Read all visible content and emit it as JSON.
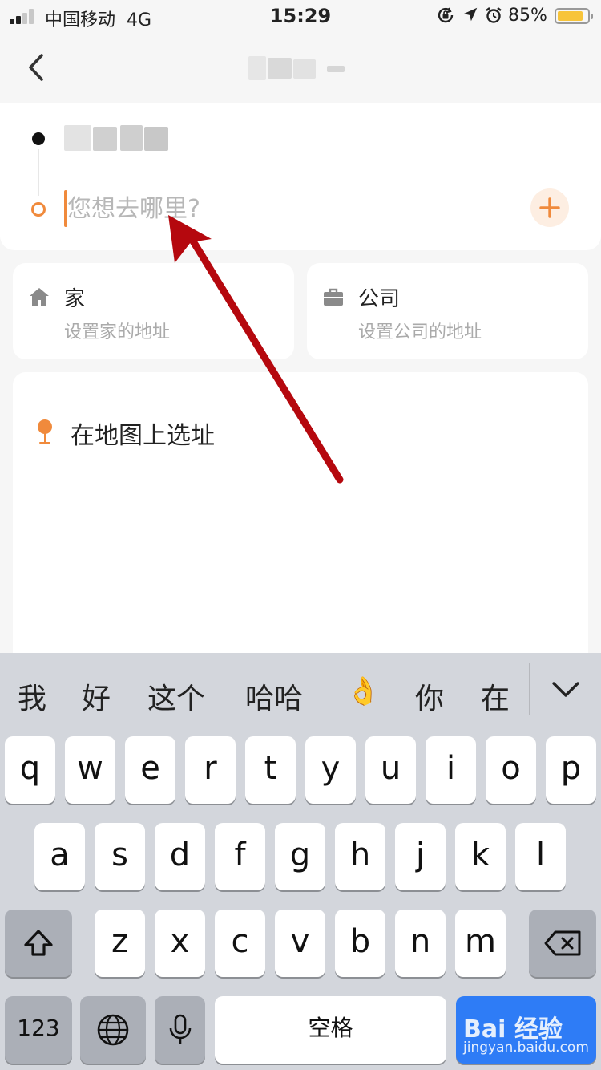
{
  "status_bar": {
    "carrier": "中国移动",
    "network": "4G",
    "time": "15:29",
    "battery": "85%",
    "battery_level": 0.85
  },
  "route": {
    "destination_placeholder": "您想去哪里?"
  },
  "quick": {
    "home": {
      "title": "家",
      "subtitle": "设置家的地址"
    },
    "work": {
      "title": "公司",
      "subtitle": "设置公司的地址"
    }
  },
  "map_pick": {
    "label": "在地图上选址"
  },
  "keyboard": {
    "suggestions": [
      "我",
      "好",
      "这个",
      "哈哈",
      "👌",
      "你",
      "在"
    ],
    "row1": [
      "q",
      "w",
      "e",
      "r",
      "t",
      "y",
      "u",
      "i",
      "o",
      "p"
    ],
    "row2": [
      "a",
      "s",
      "d",
      "f",
      "g",
      "h",
      "j",
      "k",
      "l"
    ],
    "row3": [
      "z",
      "x",
      "c",
      "v",
      "b",
      "n",
      "m"
    ],
    "numbers_key": "123",
    "space_key": "空格"
  },
  "watermark": {
    "main": "Bai 经验",
    "sub": "jingyan.baidu.com"
  },
  "colors": {
    "accent": "#f08a3c",
    "arrow": "#b5080e",
    "go_key": "#2e7cf6"
  }
}
